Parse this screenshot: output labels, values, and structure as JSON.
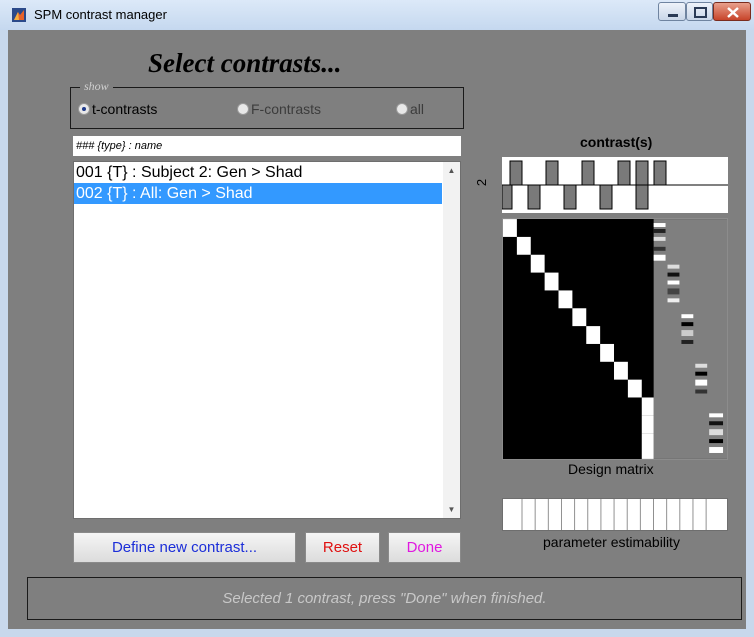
{
  "window": {
    "title": "SPM contrast manager",
    "icon": "matlab-icon"
  },
  "header": {
    "title": "Select contrasts..."
  },
  "show": {
    "legend": "show",
    "options": [
      {
        "label": "t-contrasts",
        "selected": true
      },
      {
        "label": "F-contrasts",
        "selected": false
      },
      {
        "label": "all",
        "selected": false
      }
    ]
  },
  "list": {
    "header": "### {type} : name",
    "items": [
      {
        "label": "001 {T} : Subject 2: Gen > Shad",
        "selected": false
      },
      {
        "label": "002 {T} : All: Gen > Shad",
        "selected": true
      }
    ]
  },
  "buttons": {
    "define": {
      "label": "Define new contrast...",
      "color": "#1c2ed8"
    },
    "reset": {
      "label": "Reset",
      "color": "#e01010"
    },
    "done": {
      "label": "Done",
      "color": "#e018e0"
    }
  },
  "contrast_panel": {
    "title": "contrast(s)",
    "contrast_number": "2",
    "design_label": "Design matrix",
    "estimability_label": "parameter estimability"
  },
  "status": {
    "message": "Selected 1 contrast, press \"Done\" when finished."
  },
  "colors": {
    "background": "#7f7f7f",
    "selection": "#3399ff",
    "titlebar": "#c8d8ec"
  }
}
